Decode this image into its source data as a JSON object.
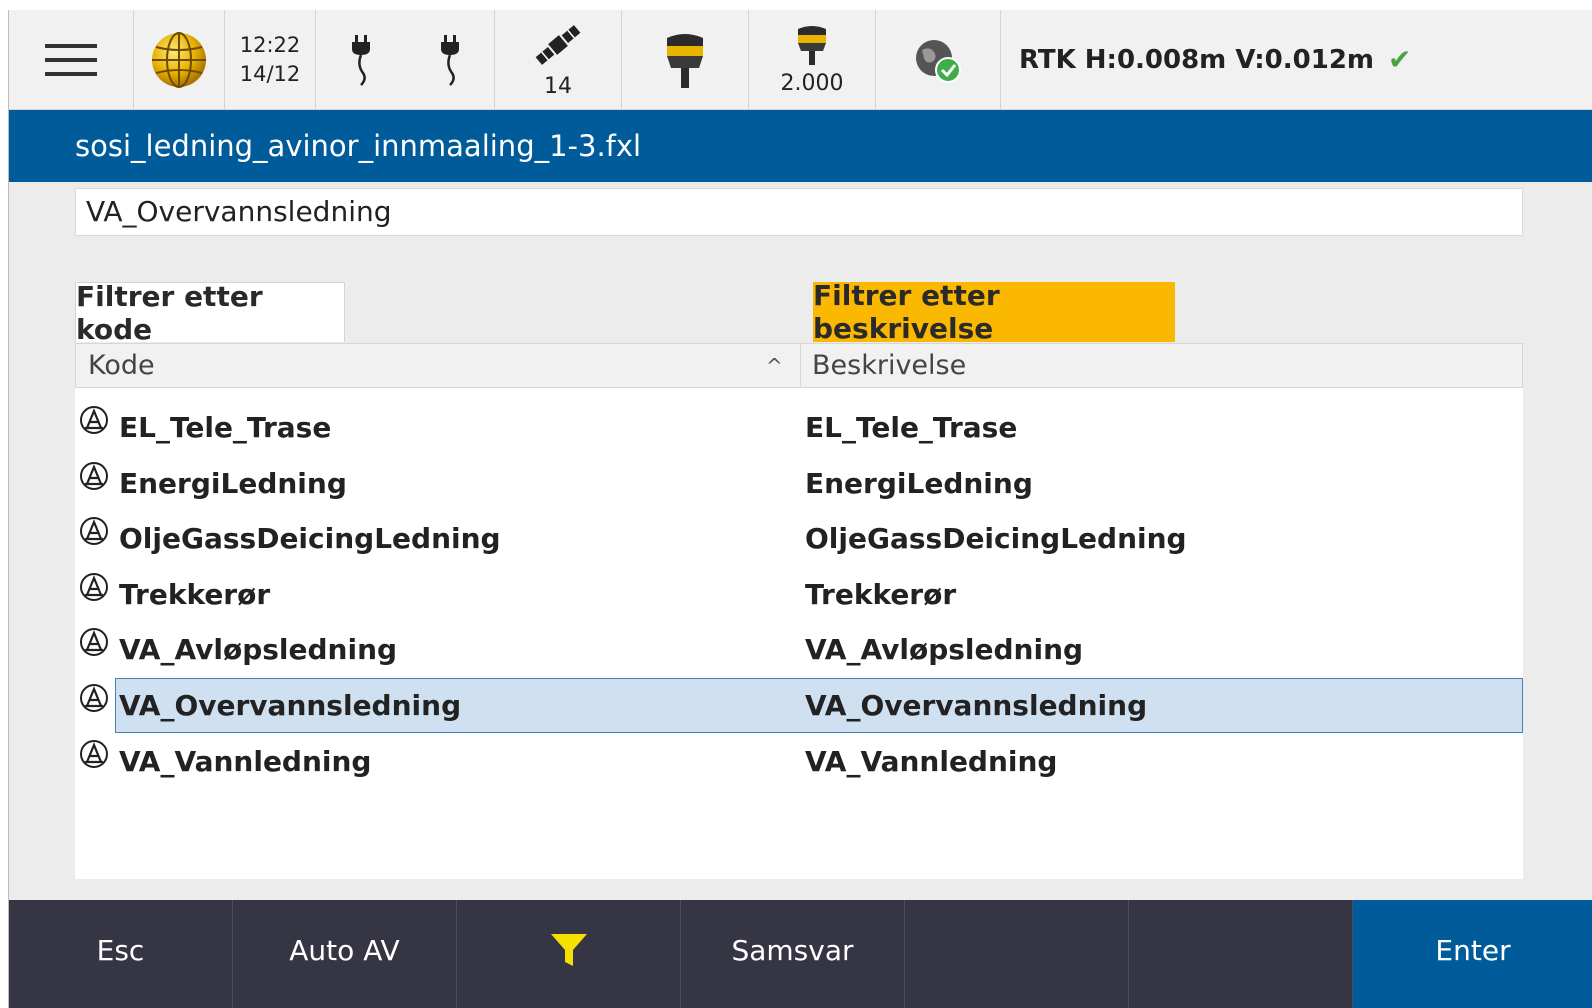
{
  "status": {
    "time": "12:22",
    "date": "14/12",
    "satellites": "14",
    "antenna_height": "2.000",
    "rtk_text": "RTK H:0.008m V:0.012m",
    "icons": [
      "menu-icon",
      "globe-icon",
      "power-plug-icon",
      "satellite-icon",
      "gnss-receiver-icon",
      "antenna-height-icon",
      "network-check-icon",
      "check-icon"
    ]
  },
  "title": "sosi_ledning_avinor_innmaaling_1-3.fxl",
  "search_value": "VA_Overvannsledning",
  "filter": {
    "by_code": "Filtrer etter kode",
    "by_description": "Filtrer etter beskrivelse"
  },
  "table": {
    "headers": {
      "code": "Kode",
      "description": "Beskrivelse"
    },
    "rows": [
      {
        "code": "EL_Tele_Trase",
        "description": "EL_Tele_Trase"
      },
      {
        "code": "EnergiLedning",
        "description": "EnergiLedning"
      },
      {
        "code": "OljeGassDeicingLedning",
        "description": "OljeGassDeicingLedning"
      },
      {
        "code": "Trekkerør",
        "description": "Trekkerør"
      },
      {
        "code": "VA_Avløpsledning",
        "description": "VA_Avløpsledning"
      },
      {
        "code": "VA_Overvannsledning",
        "description": "VA_Overvannsledning"
      },
      {
        "code": "VA_Vannledning",
        "description": "VA_Vannledning"
      }
    ],
    "selected_index": 5
  },
  "softkeys": {
    "esc": "Esc",
    "auto": "Auto AV",
    "match": "Samsvar",
    "enter": "Enter"
  },
  "colors": {
    "title_bar": "#005b9a",
    "active_filter": "#fbb800",
    "softkey_bar": "#353543",
    "selected_row": "#cfe0f0"
  }
}
